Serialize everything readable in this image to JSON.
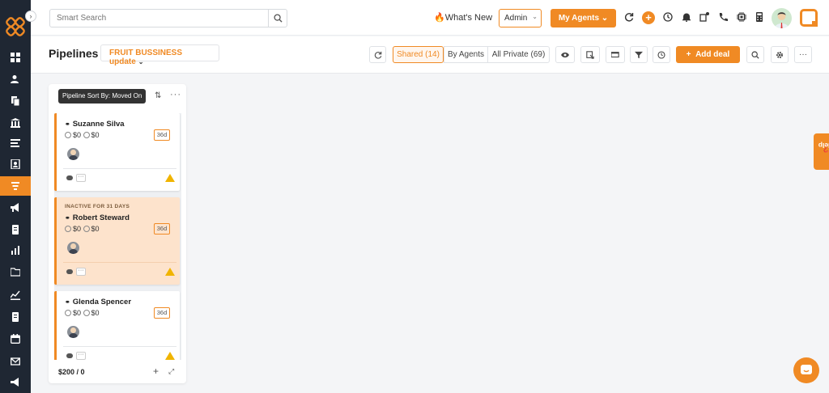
{
  "topbar": {
    "search_placeholder": "Smart Search",
    "whats_new": "What's New",
    "admin_label": "Admin",
    "my_agents_label": "My Agents"
  },
  "header": {
    "title": "Pipelines",
    "pipeline_name": "FRUIT BUSSINESS update",
    "shared_label": "Shared (14)",
    "by_agents_label": "By Agents",
    "all_private_label": "All Private (69)",
    "add_deal_label": "Add deal"
  },
  "column": {
    "tooltip": "Pipeline Sort By: Moved On",
    "footer_total": "$200 / 0",
    "cards": [
      {
        "name": "Suzanne Silva",
        "amount_a": "$0",
        "amount_b": "$0",
        "days": "36d",
        "inactive": ""
      },
      {
        "name": "Robert Steward",
        "amount_a": "$0",
        "amount_b": "$0",
        "days": "36d",
        "inactive": "INACTIVE FOR 31 DAYS"
      },
      {
        "name": "Glenda Spencer",
        "amount_a": "$0",
        "amount_b": "$0",
        "days": "36d",
        "inactive": ""
      }
    ]
  },
  "help": {
    "label": "Help"
  },
  "colors": {
    "accent": "#f08a24",
    "sidebar": "#1f2733",
    "inactive_card": "#fde3cc",
    "warning": "#f0b400"
  },
  "icons": [
    "dashboard-icon",
    "contacts-icon",
    "documents-icon",
    "bank-icon",
    "list-icon",
    "contact-card-icon",
    "pipeline-funnel-icon",
    "megaphone-icon",
    "notes-icon",
    "reports-icon",
    "folder-icon",
    "analytics-icon",
    "calendar-icon",
    "email-icon",
    "announcement-icon"
  ]
}
